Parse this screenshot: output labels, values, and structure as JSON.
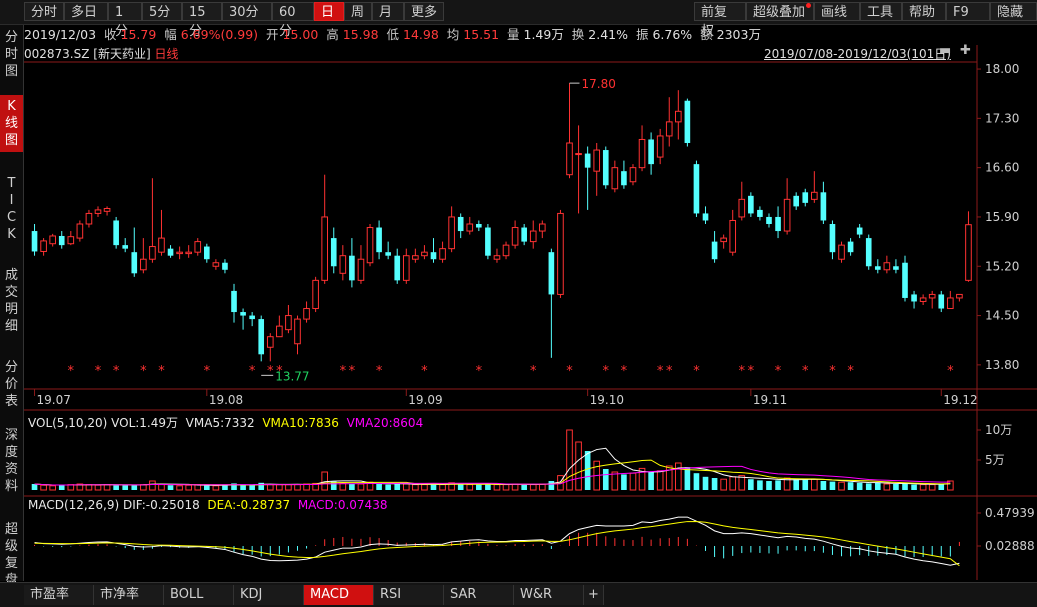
{
  "toolbar": {
    "left": [
      "分时",
      "多日",
      "1分",
      "5分",
      "15分",
      "30分",
      "60分",
      "日",
      "周",
      "月",
      "更多"
    ],
    "active": "日",
    "right": [
      "前复权",
      "超级叠加",
      "画线",
      "工具",
      "帮助",
      "F9",
      "隐藏"
    ]
  },
  "quote": {
    "date": "2019/12/03",
    "close_label": "收",
    "close": "15.79",
    "change_label": "幅",
    "change": "6.69%(0.99)",
    "open_label": "开",
    "open": "15.00",
    "high_label": "高",
    "high": "15.98",
    "low_label": "低",
    "low": "14.98",
    "avg_label": "均",
    "avg": "15.51",
    "vol_label": "量",
    "vol": "1.49万",
    "turnover_label": "换",
    "turnover": "2.41%",
    "amplitude_label": "振",
    "amplitude": "6.76%",
    "amount_label": "额",
    "amount": "2303万"
  },
  "stock": {
    "code": "002873.SZ",
    "name": "[新天药业]",
    "period": "日线"
  },
  "range": "2019/07/08-2019/12/03(101日)",
  "sidebar": [
    {
      "label": "分时图",
      "active": false
    },
    {
      "label": "K线图",
      "active": true
    },
    {
      "label": "TICK",
      "active": false
    },
    {
      "label": "成交明细",
      "active": false
    },
    {
      "label": "分价表",
      "active": false
    },
    {
      "label": "深度资料",
      "active": false
    },
    {
      "label": "超级复盘",
      "active": false
    }
  ],
  "bottom_tabs": [
    "市盈率",
    "市净率",
    "BOLL",
    "KDJ",
    "MACD",
    "RSI",
    "SAR",
    "W&R"
  ],
  "bottom_active": "MACD",
  "bottom_add": "+",
  "vol_header": {
    "name": "VOL(5,10,20)",
    "vol": "VOL:1.49万",
    "ma5": "VMA5:7332",
    "ma10": "VMA10:7836",
    "ma20": "VMA20:8604"
  },
  "macd_header": {
    "name": "MACD(12,26,9)",
    "dif": "DIF:-0.25018",
    "dea": "DEA:-0.28737",
    "macd": "MACD:0.07438"
  },
  "colors": {
    "up": "#ff3232",
    "down": "#54ffff",
    "ma5": "#ffffff",
    "ma10": "#ffff00",
    "ma20": "#ff00ff",
    "bg": "#000000"
  },
  "chart_data": {
    "type": "candlestick",
    "price_axis": {
      "ticks": [
        "18.00",
        "17.30",
        "16.60",
        "15.90",
        "15.20",
        "14.50",
        "13.80"
      ],
      "ylim": [
        13.5,
        18.1
      ]
    },
    "x_ticks": [
      "19.07",
      "19.08",
      "19.09",
      "19.10",
      "19.11",
      "19.12"
    ],
    "x_tick_index": [
      0,
      19,
      41,
      61,
      79,
      100
    ],
    "max_label": "17.80",
    "max_index": 59,
    "min_label": "13.77",
    "min_index": 25,
    "vol_axis": [
      "10万",
      "5万"
    ],
    "macd_axis": [
      "0.47939",
      "0.02888"
    ],
    "star_index": [
      4,
      7,
      9,
      12,
      14,
      19,
      24,
      26,
      27,
      34,
      35,
      38,
      43,
      49,
      55,
      59,
      63,
      65,
      69,
      70,
      73,
      78,
      79,
      82,
      85,
      88,
      90,
      101
    ],
    "candles": [
      [
        15.7,
        15.41,
        15.8,
        15.35
      ],
      [
        15.41,
        15.56,
        15.6,
        15.35
      ],
      [
        15.52,
        15.63,
        15.66,
        15.48
      ],
      [
        15.63,
        15.5,
        15.7,
        15.45
      ],
      [
        15.52,
        15.62,
        15.7,
        15.5
      ],
      [
        15.6,
        15.8,
        15.85,
        15.55
      ],
      [
        15.8,
        15.95,
        16.0,
        15.75
      ],
      [
        15.95,
        16.0,
        16.05,
        15.9
      ],
      [
        15.98,
        16.02,
        16.05,
        15.92
      ],
      [
        15.85,
        15.5,
        15.9,
        15.45
      ],
      [
        15.5,
        15.45,
        15.6,
        15.4
      ],
      [
        15.4,
        15.1,
        15.75,
        15.05
      ],
      [
        15.15,
        15.3,
        15.6,
        15.1
      ],
      [
        15.3,
        15.48,
        16.45,
        15.25
      ],
      [
        15.4,
        15.6,
        16.0,
        15.35
      ],
      [
        15.45,
        15.35,
        15.5,
        15.32
      ],
      [
        15.38,
        15.4,
        15.48,
        15.3
      ],
      [
        15.38,
        15.4,
        15.5,
        15.32
      ],
      [
        15.4,
        15.55,
        15.6,
        15.35
      ],
      [
        15.48,
        15.3,
        15.52,
        15.25
      ],
      [
        15.2,
        15.25,
        15.3,
        15.15
      ],
      [
        15.25,
        15.15,
        15.3,
        15.1
      ],
      [
        14.85,
        14.55,
        14.95,
        14.4
      ],
      [
        14.55,
        14.5,
        14.6,
        14.3
      ],
      [
        14.5,
        14.45,
        14.55,
        14.35
      ],
      [
        14.45,
        13.95,
        14.5,
        13.85
      ],
      [
        14.05,
        14.2,
        14.25,
        13.85
      ],
      [
        14.2,
        14.35,
        14.5,
        14.2
      ],
      [
        14.3,
        14.5,
        14.65,
        14.25
      ],
      [
        14.1,
        14.45,
        14.5,
        13.95
      ],
      [
        14.45,
        14.6,
        14.7,
        14.4
      ],
      [
        14.6,
        15.0,
        15.05,
        14.55
      ],
      [
        15.0,
        15.9,
        16.5,
        14.95
      ],
      [
        15.6,
        15.2,
        15.75,
        15.1
      ],
      [
        15.1,
        15.35,
        15.5,
        15.0
      ],
      [
        15.35,
        15.0,
        15.6,
        14.9
      ],
      [
        15.0,
        15.3,
        15.5,
        14.95
      ],
      [
        15.25,
        15.75,
        15.8,
        15.2
      ],
      [
        15.75,
        15.4,
        15.85,
        15.3
      ],
      [
        15.4,
        15.35,
        15.55,
        15.3
      ],
      [
        15.35,
        15.0,
        15.45,
        14.95
      ],
      [
        15.0,
        15.35,
        15.45,
        14.95
      ],
      [
        15.3,
        15.35,
        15.45,
        15.25
      ],
      [
        15.35,
        15.4,
        15.5,
        15.3
      ],
      [
        15.4,
        15.3,
        15.6,
        15.25
      ],
      [
        15.3,
        15.45,
        15.55,
        15.25
      ],
      [
        15.45,
        15.9,
        16.05,
        15.4
      ],
      [
        15.9,
        15.7,
        15.95,
        15.6
      ],
      [
        15.7,
        15.8,
        15.9,
        15.65
      ],
      [
        15.8,
        15.75,
        15.85,
        15.7
      ],
      [
        15.75,
        15.35,
        15.8,
        15.3
      ],
      [
        15.3,
        15.35,
        15.45,
        15.25
      ],
      [
        15.35,
        15.5,
        15.55,
        15.3
      ],
      [
        15.5,
        15.75,
        15.85,
        15.45
      ],
      [
        15.75,
        15.55,
        15.8,
        15.5
      ],
      [
        15.55,
        15.7,
        15.85,
        15.45
      ],
      [
        15.7,
        15.8,
        15.85,
        15.6
      ],
      [
        15.4,
        14.8,
        15.45,
        13.9
      ],
      [
        14.8,
        15.95,
        16.0,
        14.75
      ],
      [
        16.5,
        16.95,
        17.8,
        16.45
      ],
      [
        16.8,
        16.8,
        17.2,
        15.95
      ],
      [
        16.8,
        16.6,
        16.9,
        16.0
      ],
      [
        16.55,
        16.85,
        16.95,
        16.2
      ],
      [
        16.85,
        16.35,
        16.9,
        16.3
      ],
      [
        16.3,
        16.6,
        16.7,
        16.25
      ],
      [
        16.55,
        16.35,
        16.7,
        16.3
      ],
      [
        16.4,
        16.6,
        16.65,
        16.35
      ],
      [
        16.6,
        17.0,
        17.2,
        16.55
      ],
      [
        17.0,
        16.65,
        17.1,
        16.5
      ],
      [
        16.75,
        17.05,
        17.15,
        16.65
      ],
      [
        17.05,
        17.25,
        17.6,
        16.9
      ],
      [
        17.25,
        17.4,
        17.7,
        17.0
      ],
      [
        17.55,
        16.95,
        17.58,
        16.9
      ],
      [
        16.65,
        15.95,
        16.7,
        15.9
      ],
      [
        15.95,
        15.85,
        16.05,
        15.8
      ],
      [
        15.55,
        15.3,
        15.7,
        15.25
      ],
      [
        15.55,
        15.6,
        15.65,
        15.45
      ],
      [
        15.4,
        15.85,
        16.0,
        15.35
      ],
      [
        15.9,
        16.15,
        16.4,
        15.85
      ],
      [
        16.2,
        15.95,
        16.25,
        15.9
      ],
      [
        16.0,
        15.9,
        16.05,
        15.85
      ],
      [
        15.9,
        15.8,
        15.95,
        15.75
      ],
      [
        15.9,
        15.7,
        16.05,
        15.6
      ],
      [
        15.7,
        16.15,
        16.45,
        15.65
      ],
      [
        16.2,
        16.05,
        16.25,
        16.0
      ],
      [
        16.25,
        16.1,
        16.3,
        16.05
      ],
      [
        16.15,
        16.25,
        16.55,
        16.1
      ],
      [
        16.25,
        15.85,
        16.4,
        15.8
      ],
      [
        15.8,
        15.4,
        15.85,
        15.3
      ],
      [
        15.3,
        15.5,
        15.55,
        15.25
      ],
      [
        15.55,
        15.4,
        15.6,
        15.35
      ],
      [
        15.75,
        15.65,
        15.8,
        15.6
      ],
      [
        15.6,
        15.2,
        15.65,
        15.15
      ],
      [
        15.2,
        15.15,
        15.3,
        15.1
      ],
      [
        15.15,
        15.25,
        15.35,
        15.1
      ],
      [
        15.2,
        15.15,
        15.3,
        15.1
      ],
      [
        15.25,
        14.75,
        15.35,
        14.7
      ],
      [
        14.8,
        14.7,
        14.85,
        14.6
      ],
      [
        14.7,
        14.75,
        14.8,
        14.65
      ],
      [
        14.75,
        14.8,
        14.85,
        14.6
      ],
      [
        14.8,
        14.6,
        14.85,
        14.55
      ],
      [
        14.6,
        14.75,
        14.85,
        14.6
      ],
      [
        14.75,
        14.8,
        14.8,
        14.7
      ],
      [
        15.0,
        15.79,
        15.98,
        14.98
      ]
    ],
    "volume": [
      1.0,
      0.8,
      0.7,
      0.8,
      0.9,
      1.0,
      0.9,
      0.8,
      0.9,
      0.8,
      0.9,
      0.8,
      0.9,
      1.5,
      0.9,
      0.8,
      0.7,
      0.8,
      0.9,
      0.8,
      0.7,
      0.8,
      1.1,
      0.9,
      0.8,
      1.2,
      0.9,
      0.9,
      0.9,
      0.9,
      1.0,
      1.1,
      3.0,
      1.4,
      1.1,
      1.0,
      1.0,
      1.3,
      1.0,
      0.9,
      1.0,
      1.0,
      0.9,
      0.9,
      0.9,
      0.9,
      1.2,
      1.0,
      0.9,
      0.9,
      1.0,
      0.9,
      0.9,
      1.0,
      0.9,
      0.9,
      1.0,
      1.5,
      2.4,
      12.0,
      8.0,
      6.5,
      4.8,
      3.5,
      3.0,
      2.6,
      2.8,
      3.6,
      3.0,
      3.2,
      4.0,
      4.5,
      3.8,
      2.8,
      2.2,
      2.0,
      1.8,
      2.2,
      2.4,
      1.8,
      1.6,
      1.5,
      1.6,
      2.0,
      1.8,
      1.8,
      1.8,
      1.5,
      1.4,
      1.3,
      1.3,
      1.2,
      1.1,
      1.2,
      1.0,
      1.0,
      1.1,
      0.9,
      0.9,
      0.9,
      1.0,
      1.5
    ],
    "dif": [
      0.05,
      0.035,
      0.03,
      0.025,
      0.03,
      0.04,
      0.05,
      0.058,
      0.06,
      0.04,
      0.02,
      -0.005,
      -0.015,
      -0.01,
      0.005,
      0.0,
      -0.01,
      -0.015,
      -0.01,
      -0.02,
      -0.035,
      -0.05,
      -0.09,
      -0.125,
      -0.15,
      -0.19,
      -0.21,
      -0.215,
      -0.21,
      -0.205,
      -0.19,
      -0.16,
      -0.09,
      -0.06,
      -0.03,
      -0.03,
      -0.015,
      0.02,
      0.03,
      0.025,
      0.01,
      0.015,
      0.02,
      0.025,
      0.02,
      0.025,
      0.06,
      0.07,
      0.085,
      0.09,
      0.075,
      0.065,
      0.065,
      0.08,
      0.08,
      0.085,
      0.09,
      0.04,
      0.07,
      0.18,
      0.24,
      0.27,
      0.3,
      0.29,
      0.29,
      0.29,
      0.3,
      0.35,
      0.34,
      0.37,
      0.39,
      0.42,
      0.42,
      0.36,
      0.3,
      0.22,
      0.18,
      0.18,
      0.19,
      0.18,
      0.16,
      0.14,
      0.12,
      0.14,
      0.13,
      0.11,
      0.1,
      0.07,
      0.03,
      -0.005,
      -0.03,
      -0.04,
      -0.07,
      -0.09,
      -0.105,
      -0.12,
      -0.16,
      -0.19,
      -0.215,
      -0.23,
      -0.255,
      -0.28,
      -0.25
    ],
    "dea": [
      0.04,
      0.039,
      0.037,
      0.035,
      0.034,
      0.035,
      0.038,
      0.042,
      0.045,
      0.044,
      0.039,
      0.03,
      0.021,
      0.015,
      0.013,
      0.01,
      0.006,
      0.002,
      -0.001,
      -0.005,
      -0.011,
      -0.019,
      -0.033,
      -0.051,
      -0.071,
      -0.095,
      -0.118,
      -0.137,
      -0.152,
      -0.162,
      -0.167,
      -0.166,
      -0.151,
      -0.133,
      -0.112,
      -0.096,
      -0.08,
      -0.06,
      -0.042,
      -0.029,
      -0.021,
      -0.014,
      -0.007,
      -0.001,
      0.003,
      0.007,
      0.018,
      0.028,
      0.04,
      0.05,
      0.055,
      0.057,
      0.059,
      0.063,
      0.066,
      0.07,
      0.074,
      0.067,
      0.068,
      0.09,
      0.12,
      0.15,
      0.18,
      0.202,
      0.219,
      0.233,
      0.246,
      0.267,
      0.282,
      0.3,
      0.318,
      0.338,
      0.355,
      0.356,
      0.345,
      0.32,
      0.292,
      0.27,
      0.254,
      0.239,
      0.223,
      0.207,
      0.19,
      0.18,
      0.17,
      0.158,
      0.146,
      0.131,
      0.111,
      0.088,
      0.064,
      0.043,
      0.02,
      -0.002,
      -0.023,
      -0.042,
      -0.066,
      -0.09,
      -0.115,
      -0.138,
      -0.161,
      -0.185,
      -0.287
    ],
    "macd": [
      0.02,
      -0.008,
      -0.014,
      -0.02,
      -0.008,
      0.01,
      0.024,
      0.032,
      0.03,
      -0.008,
      -0.038,
      -0.07,
      -0.072,
      -0.05,
      -0.016,
      -0.02,
      -0.032,
      -0.034,
      -0.018,
      -0.03,
      -0.048,
      -0.062,
      -0.114,
      -0.148,
      -0.158,
      -0.19,
      -0.184,
      -0.156,
      -0.116,
      -0.086,
      -0.046,
      0.012,
      0.122,
      0.146,
      0.164,
      0.132,
      0.13,
      0.16,
      0.144,
      0.108,
      0.062,
      0.058,
      0.054,
      0.052,
      0.034,
      0.036,
      0.084,
      0.084,
      0.09,
      0.08,
      0.04,
      0.016,
      0.012,
      0.034,
      0.028,
      0.03,
      0.032,
      -0.054,
      0.004,
      0.18,
      0.24,
      0.24,
      0.24,
      0.176,
      0.142,
      0.114,
      0.108,
      0.166,
      0.116,
      0.14,
      0.144,
      0.164,
      0.13,
      0.008,
      -0.09,
      -0.2,
      -0.224,
      -0.18,
      -0.128,
      -0.118,
      -0.126,
      -0.134,
      -0.14,
      -0.08,
      -0.08,
      -0.096,
      -0.092,
      -0.122,
      -0.162,
      -0.186,
      -0.188,
      -0.166,
      -0.18,
      -0.176,
      -0.164,
      -0.156,
      -0.188,
      -0.2,
      -0.2,
      -0.184,
      -0.188,
      -0.19,
      0.074
    ]
  }
}
